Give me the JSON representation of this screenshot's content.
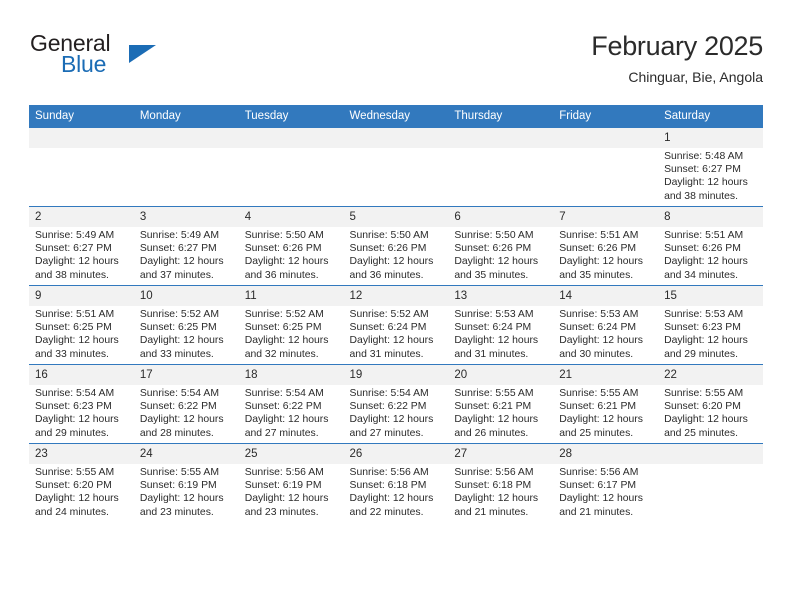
{
  "brand": {
    "name_part1": "General",
    "name_part2": "Blue",
    "triangle_color": "#1b6cb5"
  },
  "header": {
    "title": "February 2025",
    "subtitle": "Chinguar, Bie, Angola",
    "accent_color": "#3279be",
    "daynum_background": "#f2f2f2"
  },
  "weekdays": [
    "Sunday",
    "Monday",
    "Tuesday",
    "Wednesday",
    "Thursday",
    "Friday",
    "Saturday"
  ],
  "labels": {
    "sunrise": "Sunrise:",
    "sunset": "Sunset:",
    "daylight": "Daylight:"
  },
  "weeks": [
    [
      {
        "empty": true,
        "day": ""
      },
      {
        "empty": true,
        "day": ""
      },
      {
        "empty": true,
        "day": ""
      },
      {
        "empty": true,
        "day": ""
      },
      {
        "empty": true,
        "day": ""
      },
      {
        "empty": true,
        "day": ""
      },
      {
        "empty": false,
        "day": "1",
        "sunrise": "Sunrise: 5:48 AM",
        "sunset": "Sunset: 6:27 PM",
        "daylight": "Daylight: 12 hours and 38 minutes."
      }
    ],
    [
      {
        "empty": false,
        "day": "2",
        "sunrise": "Sunrise: 5:49 AM",
        "sunset": "Sunset: 6:27 PM",
        "daylight": "Daylight: 12 hours and 38 minutes."
      },
      {
        "empty": false,
        "day": "3",
        "sunrise": "Sunrise: 5:49 AM",
        "sunset": "Sunset: 6:27 PM",
        "daylight": "Daylight: 12 hours and 37 minutes."
      },
      {
        "empty": false,
        "day": "4",
        "sunrise": "Sunrise: 5:50 AM",
        "sunset": "Sunset: 6:26 PM",
        "daylight": "Daylight: 12 hours and 36 minutes."
      },
      {
        "empty": false,
        "day": "5",
        "sunrise": "Sunrise: 5:50 AM",
        "sunset": "Sunset: 6:26 PM",
        "daylight": "Daylight: 12 hours and 36 minutes."
      },
      {
        "empty": false,
        "day": "6",
        "sunrise": "Sunrise: 5:50 AM",
        "sunset": "Sunset: 6:26 PM",
        "daylight": "Daylight: 12 hours and 35 minutes."
      },
      {
        "empty": false,
        "day": "7",
        "sunrise": "Sunrise: 5:51 AM",
        "sunset": "Sunset: 6:26 PM",
        "daylight": "Daylight: 12 hours and 35 minutes."
      },
      {
        "empty": false,
        "day": "8",
        "sunrise": "Sunrise: 5:51 AM",
        "sunset": "Sunset: 6:26 PM",
        "daylight": "Daylight: 12 hours and 34 minutes."
      }
    ],
    [
      {
        "empty": false,
        "day": "9",
        "sunrise": "Sunrise: 5:51 AM",
        "sunset": "Sunset: 6:25 PM",
        "daylight": "Daylight: 12 hours and 33 minutes."
      },
      {
        "empty": false,
        "day": "10",
        "sunrise": "Sunrise: 5:52 AM",
        "sunset": "Sunset: 6:25 PM",
        "daylight": "Daylight: 12 hours and 33 minutes."
      },
      {
        "empty": false,
        "day": "11",
        "sunrise": "Sunrise: 5:52 AM",
        "sunset": "Sunset: 6:25 PM",
        "daylight": "Daylight: 12 hours and 32 minutes."
      },
      {
        "empty": false,
        "day": "12",
        "sunrise": "Sunrise: 5:52 AM",
        "sunset": "Sunset: 6:24 PM",
        "daylight": "Daylight: 12 hours and 31 minutes."
      },
      {
        "empty": false,
        "day": "13",
        "sunrise": "Sunrise: 5:53 AM",
        "sunset": "Sunset: 6:24 PM",
        "daylight": "Daylight: 12 hours and 31 minutes."
      },
      {
        "empty": false,
        "day": "14",
        "sunrise": "Sunrise: 5:53 AM",
        "sunset": "Sunset: 6:24 PM",
        "daylight": "Daylight: 12 hours and 30 minutes."
      },
      {
        "empty": false,
        "day": "15",
        "sunrise": "Sunrise: 5:53 AM",
        "sunset": "Sunset: 6:23 PM",
        "daylight": "Daylight: 12 hours and 29 minutes."
      }
    ],
    [
      {
        "empty": false,
        "day": "16",
        "sunrise": "Sunrise: 5:54 AM",
        "sunset": "Sunset: 6:23 PM",
        "daylight": "Daylight: 12 hours and 29 minutes."
      },
      {
        "empty": false,
        "day": "17",
        "sunrise": "Sunrise: 5:54 AM",
        "sunset": "Sunset: 6:22 PM",
        "daylight": "Daylight: 12 hours and 28 minutes."
      },
      {
        "empty": false,
        "day": "18",
        "sunrise": "Sunrise: 5:54 AM",
        "sunset": "Sunset: 6:22 PM",
        "daylight": "Daylight: 12 hours and 27 minutes."
      },
      {
        "empty": false,
        "day": "19",
        "sunrise": "Sunrise: 5:54 AM",
        "sunset": "Sunset: 6:22 PM",
        "daylight": "Daylight: 12 hours and 27 minutes."
      },
      {
        "empty": false,
        "day": "20",
        "sunrise": "Sunrise: 5:55 AM",
        "sunset": "Sunset: 6:21 PM",
        "daylight": "Daylight: 12 hours and 26 minutes."
      },
      {
        "empty": false,
        "day": "21",
        "sunrise": "Sunrise: 5:55 AM",
        "sunset": "Sunset: 6:21 PM",
        "daylight": "Daylight: 12 hours and 25 minutes."
      },
      {
        "empty": false,
        "day": "22",
        "sunrise": "Sunrise: 5:55 AM",
        "sunset": "Sunset: 6:20 PM",
        "daylight": "Daylight: 12 hours and 25 minutes."
      }
    ],
    [
      {
        "empty": false,
        "day": "23",
        "sunrise": "Sunrise: 5:55 AM",
        "sunset": "Sunset: 6:20 PM",
        "daylight": "Daylight: 12 hours and 24 minutes."
      },
      {
        "empty": false,
        "day": "24",
        "sunrise": "Sunrise: 5:55 AM",
        "sunset": "Sunset: 6:19 PM",
        "daylight": "Daylight: 12 hours and 23 minutes."
      },
      {
        "empty": false,
        "day": "25",
        "sunrise": "Sunrise: 5:56 AM",
        "sunset": "Sunset: 6:19 PM",
        "daylight": "Daylight: 12 hours and 23 minutes."
      },
      {
        "empty": false,
        "day": "26",
        "sunrise": "Sunrise: 5:56 AM",
        "sunset": "Sunset: 6:18 PM",
        "daylight": "Daylight: 12 hours and 22 minutes."
      },
      {
        "empty": false,
        "day": "27",
        "sunrise": "Sunrise: 5:56 AM",
        "sunset": "Sunset: 6:18 PM",
        "daylight": "Daylight: 12 hours and 21 minutes."
      },
      {
        "empty": false,
        "day": "28",
        "sunrise": "Sunrise: 5:56 AM",
        "sunset": "Sunset: 6:17 PM",
        "daylight": "Daylight: 12 hours and 21 minutes."
      },
      {
        "empty": true,
        "day": ""
      }
    ]
  ]
}
